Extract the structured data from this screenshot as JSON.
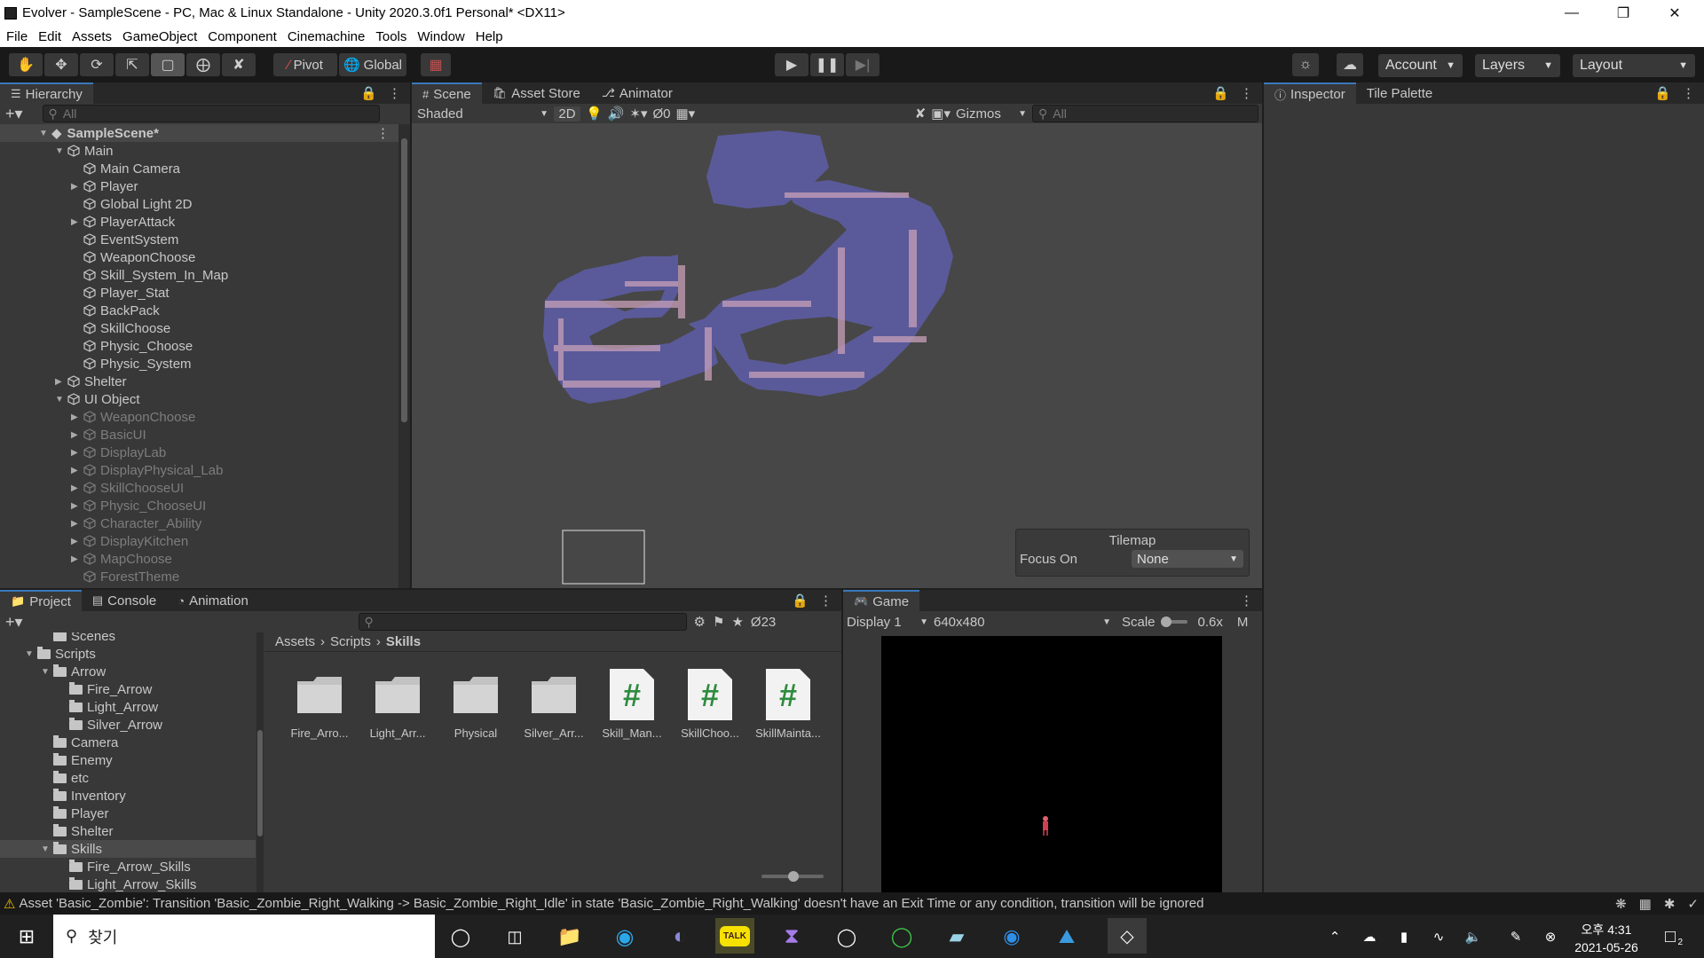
{
  "window": {
    "title": "Evolver - SampleScene - PC, Mac & Linux Standalone - Unity 2020.3.0f1 Personal* <DX11>"
  },
  "menu": [
    "File",
    "Edit",
    "Assets",
    "GameObject",
    "Component",
    "Cinemachine",
    "Tools",
    "Window",
    "Help"
  ],
  "toolbar": {
    "pivot": "Pivot",
    "global": "Global",
    "account": "Account",
    "layers": "Layers",
    "layout": "Layout"
  },
  "hierarchy": {
    "tab": "Hierarchy",
    "search_placeholder": "All",
    "scene": "SampleScene*",
    "items": [
      {
        "label": "Main",
        "depth": 1,
        "fold": "open",
        "dim": false
      },
      {
        "label": "Main Camera",
        "depth": 2,
        "fold": "none",
        "dim": false
      },
      {
        "label": "Player",
        "depth": 2,
        "fold": "closed",
        "dim": false
      },
      {
        "label": "Global Light 2D",
        "depth": 2,
        "fold": "none",
        "dim": false
      },
      {
        "label": "PlayerAttack",
        "depth": 2,
        "fold": "closed",
        "dim": false
      },
      {
        "label": "EventSystem",
        "depth": 2,
        "fold": "none",
        "dim": false
      },
      {
        "label": "WeaponChoose",
        "depth": 2,
        "fold": "none",
        "dim": false
      },
      {
        "label": "Skill_System_In_Map",
        "depth": 2,
        "fold": "none",
        "dim": false
      },
      {
        "label": "Player_Stat",
        "depth": 2,
        "fold": "none",
        "dim": false
      },
      {
        "label": "BackPack",
        "depth": 2,
        "fold": "none",
        "dim": false
      },
      {
        "label": "SkillChoose",
        "depth": 2,
        "fold": "none",
        "dim": false
      },
      {
        "label": "Physic_Choose",
        "depth": 2,
        "fold": "none",
        "dim": false
      },
      {
        "label": "Physic_System",
        "depth": 2,
        "fold": "none",
        "dim": false
      },
      {
        "label": "Shelter",
        "depth": 1,
        "fold": "closed",
        "dim": false
      },
      {
        "label": "UI Object",
        "depth": 1,
        "fold": "open",
        "dim": false
      },
      {
        "label": "WeaponChoose",
        "depth": 2,
        "fold": "closed",
        "dim": true
      },
      {
        "label": "BasicUI",
        "depth": 2,
        "fold": "closed",
        "dim": true
      },
      {
        "label": "DisplayLab",
        "depth": 2,
        "fold": "closed",
        "dim": true
      },
      {
        "label": "DisplayPhysical_Lab",
        "depth": 2,
        "fold": "closed",
        "dim": true
      },
      {
        "label": "SkillChooseUI",
        "depth": 2,
        "fold": "closed",
        "dim": true
      },
      {
        "label": "Physic_ChooseUI",
        "depth": 2,
        "fold": "closed",
        "dim": true
      },
      {
        "label": "Character_Ability",
        "depth": 2,
        "fold": "closed",
        "dim": true
      },
      {
        "label": "DisplayKitchen",
        "depth": 2,
        "fold": "closed",
        "dim": true
      },
      {
        "label": "MapChoose",
        "depth": 2,
        "fold": "closed",
        "dim": true
      },
      {
        "label": "ForestTheme",
        "depth": 2,
        "fold": "none",
        "dim": true
      }
    ]
  },
  "scene": {
    "tabs": [
      "Scene",
      "Asset Store",
      "Animator"
    ],
    "shading": "Shaded",
    "mode2d": "2D",
    "hidden_count": "0",
    "gizmos": "Gizmos",
    "search_placeholder": "All",
    "tilemap": {
      "title": "Tilemap",
      "focus_label": "Focus On",
      "focus_value": "None"
    }
  },
  "inspector": {
    "tabs": [
      "Inspector",
      "Tile Palette"
    ]
  },
  "project": {
    "tabs": [
      "Project",
      "Console",
      "Animation"
    ],
    "hidden_count": "23",
    "breadcrumb": [
      "Assets",
      "Scripts",
      "Skills"
    ],
    "tree": [
      {
        "label": "Scenes",
        "depth": 2,
        "fold": "none"
      },
      {
        "label": "Scripts",
        "depth": 1,
        "fold": "open"
      },
      {
        "label": "Arrow",
        "depth": 2,
        "fold": "open"
      },
      {
        "label": "Fire_Arrow",
        "depth": 3,
        "fold": "none"
      },
      {
        "label": "Light_Arrow",
        "depth": 3,
        "fold": "none"
      },
      {
        "label": "Silver_Arrow",
        "depth": 3,
        "fold": "none"
      },
      {
        "label": "Camera",
        "depth": 2,
        "fold": "none"
      },
      {
        "label": "Enemy",
        "depth": 2,
        "fold": "none"
      },
      {
        "label": "etc",
        "depth": 2,
        "fold": "none"
      },
      {
        "label": "Inventory",
        "depth": 2,
        "fold": "none"
      },
      {
        "label": "Player",
        "depth": 2,
        "fold": "none"
      },
      {
        "label": "Shelter",
        "depth": 2,
        "fold": "none"
      },
      {
        "label": "Skills",
        "depth": 2,
        "fold": "open"
      },
      {
        "label": "Fire_Arrow_Skills",
        "depth": 3,
        "fold": "none"
      },
      {
        "label": "Light_Arrow_Skills",
        "depth": 3,
        "fold": "none"
      }
    ],
    "assets": [
      {
        "label": "Fire_Arro...",
        "kind": "folder"
      },
      {
        "label": "Light_Arr...",
        "kind": "folder"
      },
      {
        "label": "Physical",
        "kind": "folder"
      },
      {
        "label": "Silver_Arr...",
        "kind": "folder"
      },
      {
        "label": "Skill_Man...",
        "kind": "script"
      },
      {
        "label": "SkillChoo...",
        "kind": "script"
      },
      {
        "label": "SkillMainta...",
        "kind": "script"
      }
    ]
  },
  "game": {
    "tab": "Game",
    "display": "Display 1",
    "resolution": "640x480",
    "scale_label": "Scale",
    "scale_value": "0.6x",
    "more": "M"
  },
  "status": {
    "message": "Asset 'Basic_Zombie': Transition 'Basic_Zombie_Right_Walking -> Basic_Zombie_Right_Idle' in state 'Basic_Zombie_Right_Walking' doesn't have an Exit Time or any condition, transition will be ignored"
  },
  "taskbar": {
    "search": "찾기",
    "time": "오후 4:31",
    "date": "2021-05-26",
    "notif": "2",
    "kakao": "TALK"
  },
  "colors": {
    "accent": "#3a79bb",
    "map": "#5a5a9a",
    "warn": "#f0c000"
  }
}
